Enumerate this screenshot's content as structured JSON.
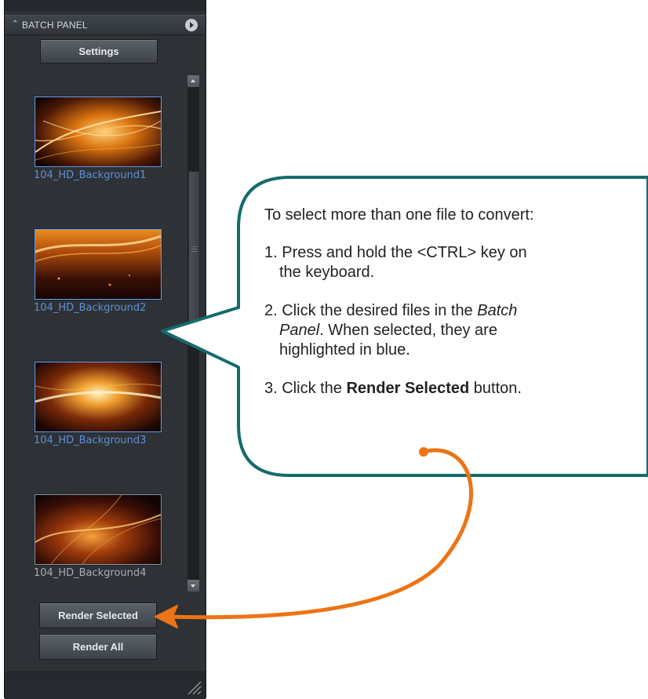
{
  "panel": {
    "title": "BATCH PANEL",
    "collapse_icon": "double-chevron-up-icon",
    "menu_icon": "circle-arrow-right-icon",
    "settings_label": "Settings",
    "render_selected_label": "Render Selected",
    "render_all_label": "Render All",
    "files": [
      {
        "name": "104_HD_Background1",
        "selected": true
      },
      {
        "name": "104_HD_Background2",
        "selected": true
      },
      {
        "name": "104_HD_Background3",
        "selected": true
      },
      {
        "name": "104_HD_Background4",
        "selected": false
      }
    ]
  },
  "callout": {
    "intro": "To select more than one file to convert:",
    "step1_a": "1. Press and hold the <CTRL> key on",
    "step1_b": "the keyboard.",
    "step2_a_plain": "2. Click the desired files in the ",
    "step2_a_italic": "Batch",
    "step2_b_italic": "Panel",
    "step2_b_plain": ". When selected, they are",
    "step2_c": "highlighted in blue.",
    "step3_pre": "3. Click the ",
    "step3_bold": "Render Selected",
    "step3_post": " button."
  },
  "colors": {
    "callout_border": "#156b6c",
    "arrow": "#ec7415",
    "selected_label": "#5f8fd4"
  }
}
